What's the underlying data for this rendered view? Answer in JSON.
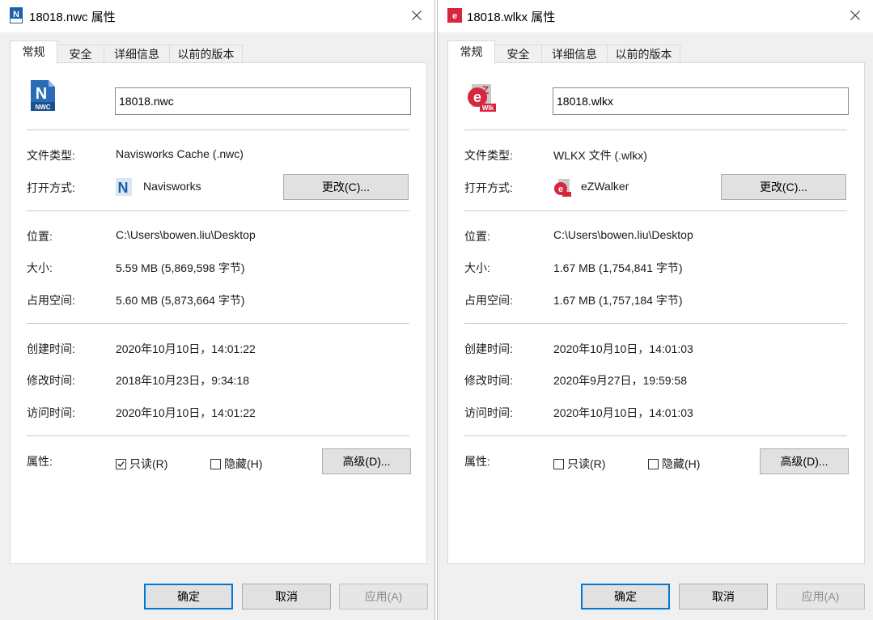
{
  "dialogs": [
    {
      "title": "18018.nwc 属性",
      "icon_name": "navisworks-nwc-file-icon",
      "big_icon_caption": "NWC",
      "tabs": [
        "常规",
        "安全",
        "详细信息",
        "以前的版本"
      ],
      "active_tab": "常规",
      "filename": "18018.nwc",
      "file_type_label": "文件类型:",
      "file_type_value": "Navisworks Cache (.nwc)",
      "opens_with_label": "打开方式:",
      "opens_with_app": "Navisworks",
      "opens_with_icon": "navisworks-app-icon",
      "change_button": "更改(C)...",
      "location_label": "位置:",
      "location_value": "C:\\Users\\bowen.liu\\Desktop",
      "size_label": "大小:",
      "size_value": "5.59 MB (5,869,598 字节)",
      "size_on_disk_label": "占用空间:",
      "size_on_disk_value": "5.60 MB (5,873,664 字节)",
      "created_label": "创建时间:",
      "created_value": "2020年10月10日，14:01:22",
      "modified_label": "修改时间:",
      "modified_value": "2018年10月23日，9:34:18",
      "accessed_label": "访问时间:",
      "accessed_value": "2020年10月10日，14:01:22",
      "attributes_label": "属性:",
      "readonly_label": "只读(R)",
      "readonly_checked": true,
      "hidden_label": "隐藏(H)",
      "hidden_checked": false,
      "advanced_button": "高级(D)...",
      "ok_button": "确定",
      "cancel_button": "取消",
      "apply_button": "应用(A)"
    },
    {
      "title": "18018.wlkx 属性",
      "icon_name": "ezwalker-wlkx-file-icon",
      "big_icon_caption": "Wlk",
      "tabs": [
        "常规",
        "安全",
        "详细信息",
        "以前的版本"
      ],
      "active_tab": "常规",
      "filename": "18018.wlkx",
      "file_type_label": "文件类型:",
      "file_type_value": "WLKX 文件 (.wlkx)",
      "opens_with_label": "打开方式:",
      "opens_with_app": "eZWalker",
      "opens_with_icon": "ezwalker-app-icon",
      "change_button": "更改(C)...",
      "location_label": "位置:",
      "location_value": "C:\\Users\\bowen.liu\\Desktop",
      "size_label": "大小:",
      "size_value": "1.67 MB (1,754,841 字节)",
      "size_on_disk_label": "占用空间:",
      "size_on_disk_value": "1.67 MB (1,757,184 字节)",
      "created_label": "创建时间:",
      "created_value": "2020年10月10日，14:01:03",
      "modified_label": "修改时间:",
      "modified_value": "2020年9月27日，19:59:58",
      "accessed_label": "访问时间:",
      "accessed_value": "2020年10月10日，14:01:03",
      "attributes_label": "属性:",
      "readonly_label": "只读(R)",
      "readonly_checked": false,
      "hidden_label": "隐藏(H)",
      "hidden_checked": false,
      "advanced_button": "高级(D)...",
      "ok_button": "确定",
      "cancel_button": "取消",
      "apply_button": "应用(A)"
    }
  ],
  "colors": {
    "dialog_bg": "#f0f0f0",
    "panel_bg": "#ffffff",
    "default_button_border": "#0078d7",
    "navisworks_blue": "#1d5fa8",
    "ezwalker_red": "#d6273f"
  }
}
